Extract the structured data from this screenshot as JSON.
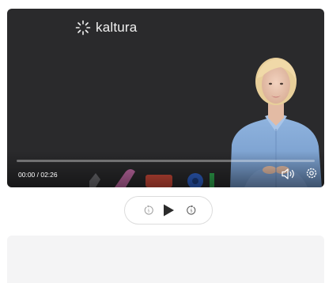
{
  "player": {
    "logo_text": "kaltura",
    "time_display": "00:00 / 02:26",
    "progress_fraction": 0,
    "icons": {
      "logo": "kaltura-logo-icon",
      "volume": "volume-icon",
      "settings": "settings-gear-icon"
    }
  },
  "controls": {
    "rewind_icon": "rewind-icon",
    "play_icon": "play-icon",
    "forward_icon": "forward-icon"
  },
  "colors": {
    "player_bg": "#2a2a2c",
    "accent": "#ffffff",
    "panel_bg": "#f4f4f5"
  }
}
